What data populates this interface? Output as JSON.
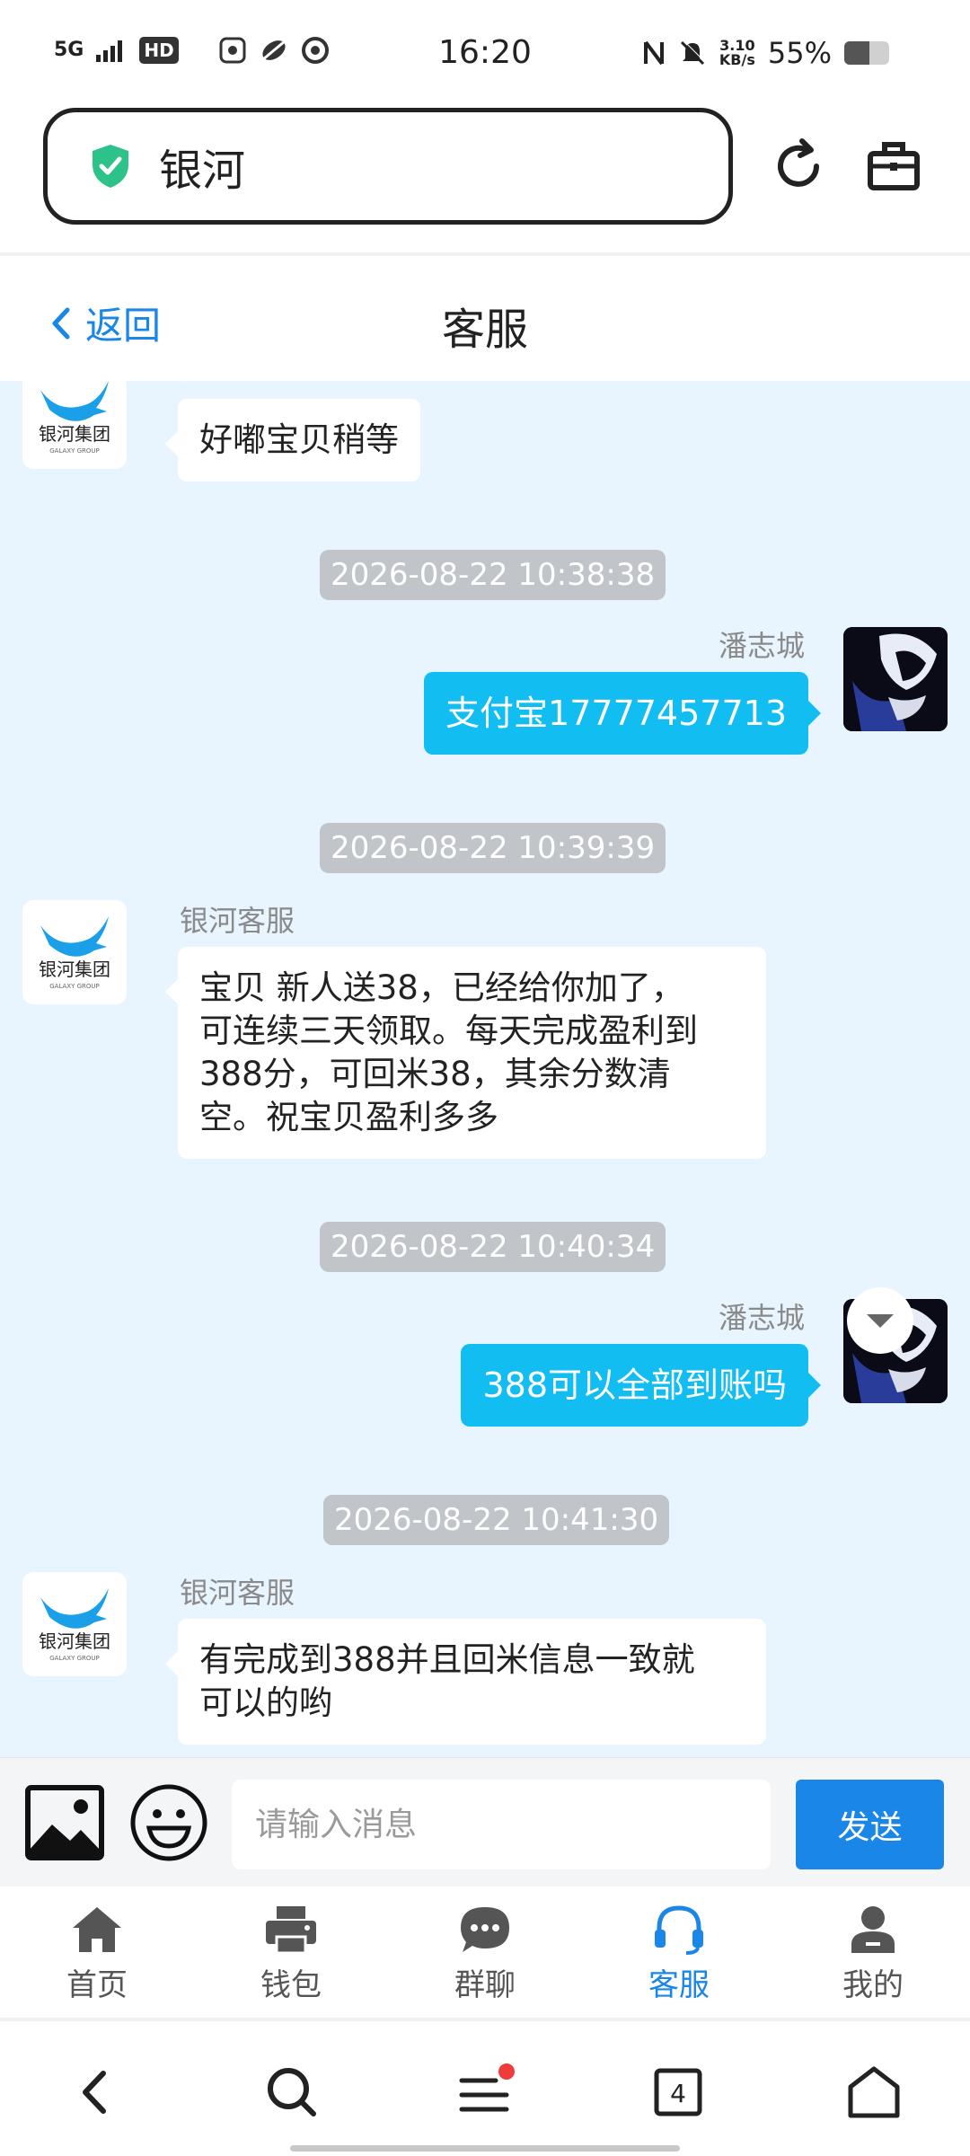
{
  "status_bar": {
    "network": "5G",
    "hd": "HD",
    "time": "16:20",
    "speed_value": "3.10",
    "speed_unit": "KB/s",
    "battery": "55%",
    "battery_level": 0.55
  },
  "browser": {
    "url_title": "银河"
  },
  "header": {
    "back_label": "返回",
    "title": "客服"
  },
  "chat": {
    "messages": [
      {
        "side": "left",
        "text": "好嘟宝贝稍等"
      },
      {
        "side": "time",
        "text": "2026-08-22 10:38:38"
      },
      {
        "side": "right",
        "sender": "潘志城",
        "text": "支付宝17777457713"
      },
      {
        "side": "time",
        "text": "2026-08-22 10:39:39"
      },
      {
        "side": "left",
        "sender": "银河客服",
        "lines": [
          "宝贝  新人送38，已经给你加了，",
          "可连续三天领取。每天完成盈利到",
          "388分，可回米38，其余分数清",
          "空。祝宝贝盈利多多"
        ]
      },
      {
        "side": "time",
        "text": "2026-08-22 10:40:34"
      },
      {
        "side": "right",
        "sender": "潘志城",
        "text": "388可以全部到账吗"
      },
      {
        "side": "time",
        "text": "2026-08-22 10:41:30"
      },
      {
        "side": "left",
        "sender": "银河客服",
        "lines": [
          "有完成到388并且回米信息一致就",
          "可以的哟"
        ]
      }
    ],
    "logo_cn": "银河集团",
    "logo_en": "GALAXY GROUP"
  },
  "composer": {
    "placeholder": "请输入消息",
    "send_label": "发送"
  },
  "nav": {
    "items": [
      {
        "label": "首页",
        "icon": "home-icon",
        "active": false
      },
      {
        "label": "钱包",
        "icon": "printer-icon",
        "active": false
      },
      {
        "label": "群聊",
        "icon": "chat-bubble-icon",
        "active": false
      },
      {
        "label": "客服",
        "icon": "headset-icon",
        "active": true
      },
      {
        "label": "我的",
        "icon": "user-icon",
        "active": false
      }
    ]
  },
  "system_nav": {
    "tab_count": "4"
  },
  "colors": {
    "accent": "#1a86e8",
    "user_bubble": "#12bdf2",
    "chat_bg": "#e8f4fe"
  }
}
